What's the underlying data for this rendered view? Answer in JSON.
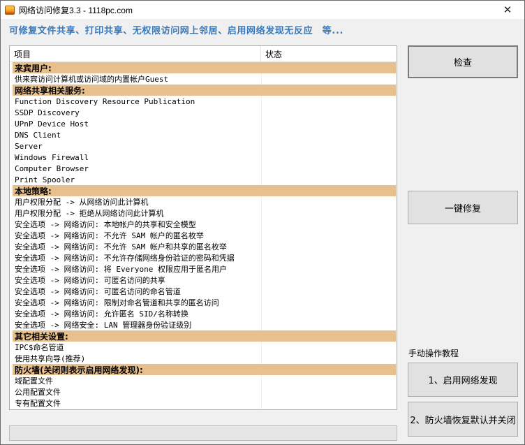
{
  "window": {
    "title": "网络访问修复3.3 - 1118pc.com",
    "close_glyph": "✕",
    "app_icon": "toolbox-icon"
  },
  "headline": "可修复文件共享、打印共享、无权限访问网上邻居、启用网络发现无反应　等...",
  "list": {
    "columns": [
      "项目",
      "状态"
    ],
    "rows": [
      {
        "text": "来宾用户:",
        "group": true,
        "status": ""
      },
      {
        "text": "供来宾访问计算机或访问域的内置帐户Guest",
        "group": false,
        "status": ""
      },
      {
        "text": "网络共享相关服务:",
        "group": true,
        "status": ""
      },
      {
        "text": "Function Discovery Resource Publication",
        "group": false,
        "status": ""
      },
      {
        "text": "SSDP Discovery",
        "group": false,
        "status": ""
      },
      {
        "text": "UPnP Device Host",
        "group": false,
        "status": ""
      },
      {
        "text": "DNS Client",
        "group": false,
        "status": ""
      },
      {
        "text": "Server",
        "group": false,
        "status": ""
      },
      {
        "text": "Windows Firewall",
        "group": false,
        "status": ""
      },
      {
        "text": "Computer Browser",
        "group": false,
        "status": ""
      },
      {
        "text": "Print Spooler",
        "group": false,
        "status": ""
      },
      {
        "text": "本地策略:",
        "group": true,
        "status": ""
      },
      {
        "text": "用户权限分配 -> 从网络访问此计算机",
        "group": false,
        "status": ""
      },
      {
        "text": "用户权限分配 -> 拒绝从网络访问此计算机",
        "group": false,
        "status": ""
      },
      {
        "text": "安全选项 -> 网络访问: 本地帐户的共享和安全模型",
        "group": false,
        "status": ""
      },
      {
        "text": "安全选项 -> 网络访问: 不允许 SAM 帐户的匿名枚举",
        "group": false,
        "status": ""
      },
      {
        "text": "安全选项 -> 网络访问: 不允许 SAM 帐户和共享的匿名枚举",
        "group": false,
        "status": ""
      },
      {
        "text": "安全选项 -> 网络访问: 不允许存储网络身份验证的密码和凭据",
        "group": false,
        "status": ""
      },
      {
        "text": "安全选项 -> 网络访问: 将 Everyone 权限应用于匿名用户",
        "group": false,
        "status": ""
      },
      {
        "text": "安全选项 -> 网络访问: 可匿名访问的共享",
        "group": false,
        "status": ""
      },
      {
        "text": "安全选项 -> 网络访问: 可匿名访问的命名管道",
        "group": false,
        "status": ""
      },
      {
        "text": "安全选项 -> 网络访问: 限制对命名管道和共享的匿名访问",
        "group": false,
        "status": ""
      },
      {
        "text": "安全选项 -> 网络访问: 允许匿名 SID/名称转换",
        "group": false,
        "status": ""
      },
      {
        "text": "安全选项 -> 网络安全: LAN 管理器身份验证级别",
        "group": false,
        "status": ""
      },
      {
        "text": "其它相关设置:",
        "group": true,
        "status": ""
      },
      {
        "text": "IPC$命名管道",
        "group": false,
        "status": ""
      },
      {
        "text": "使用共享向导(推荐)",
        "group": false,
        "status": ""
      },
      {
        "text": "防火墙(关闭则表示启用网络发现):",
        "group": true,
        "status": ""
      },
      {
        "text": "域配置文件",
        "group": false,
        "status": ""
      },
      {
        "text": "公用配置文件",
        "group": false,
        "status": ""
      },
      {
        "text": "专有配置文件",
        "group": false,
        "status": ""
      }
    ]
  },
  "buttons": {
    "check": "检查",
    "one_click_fix": "一键修复",
    "enable_discovery": "1、启用网络发现",
    "restore_firewall": "2、防火墙恢复默认并关闭"
  },
  "tutorial_label": "手动操作教程",
  "colors": {
    "headline": "#3a78b8",
    "group_row": "#e8c08e"
  }
}
